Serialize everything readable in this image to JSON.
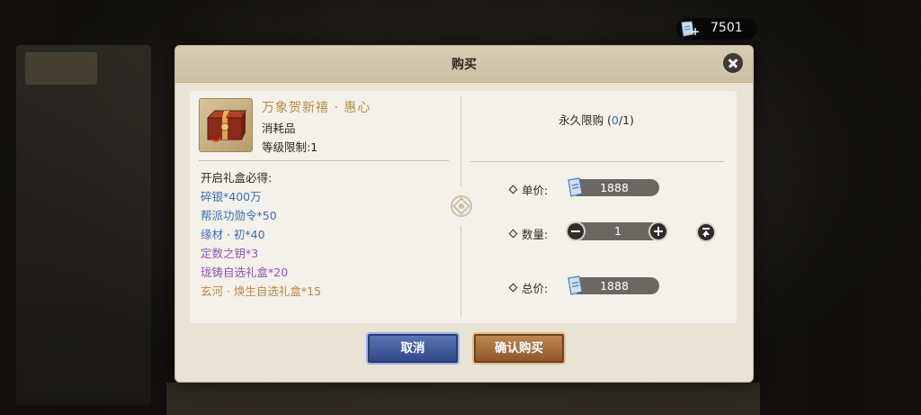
{
  "currency": {
    "icon": "ticket-icon",
    "amount": "7501"
  },
  "dialog": {
    "title": "购买",
    "item": {
      "name": "万象贺新禧 · 惠心",
      "type": "消耗品",
      "level": "等级限制:1",
      "icon": "gift-box-icon"
    },
    "rewards_title": "开启礼盒必得:",
    "rewards": [
      {
        "text": "碎银*400万",
        "color": "#3d6bb3"
      },
      {
        "text": "帮派功勋令*50",
        "color": "#3d6bb3"
      },
      {
        "text": "缘材 · 初*40",
        "color": "#3d6bb3"
      },
      {
        "text": "定数之钥*3",
        "color": "#8a55b8"
      },
      {
        "text": "珑铸自选礼盒*20",
        "color": "#8a55b8"
      },
      {
        "text": "玄河 · 焕生自选礼盒*15",
        "color": "#b98a3f"
      }
    ],
    "purchase_limit": {
      "label": "永久限购 (",
      "bought": "0",
      "sep": "/",
      "max": "1",
      "close": ")"
    },
    "unit_price_label": "单价:",
    "unit_price": "1888",
    "quantity_label": "数量:",
    "quantity": "1",
    "total_label": "总价:",
    "total_price": "1888",
    "cancel_label": "取消",
    "confirm_label": "确认购买"
  }
}
